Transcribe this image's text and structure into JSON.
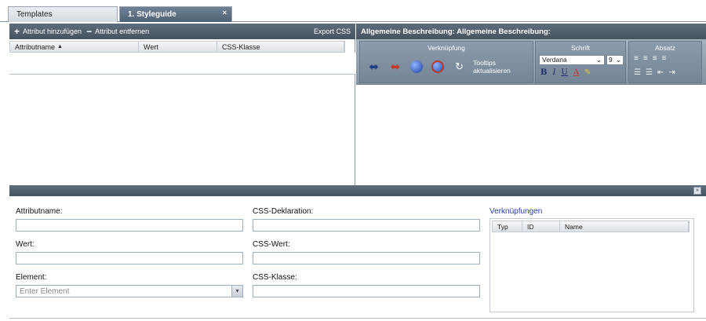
{
  "tabs": [
    {
      "label": "Templates"
    },
    {
      "label": "1. Styleguide",
      "close": "×"
    }
  ],
  "attributes_panel": {
    "add_label": "Attribut hinzufügen",
    "add_glyph": "+",
    "remove_label": "Attribut entfernen",
    "remove_glyph": "−",
    "export_label": "Export CSS",
    "columns": [
      "Attributname",
      "Wert",
      "CSS-Klasse"
    ],
    "sort_indicator": "▲"
  },
  "editor": {
    "title": "Allgemeine Beschreibung: Allgemeine Beschreibung:",
    "groups": {
      "link": "Verknüpfung",
      "font": "Schrift",
      "paragraph": "Absatz"
    },
    "tooltips_label": "Tooltips aktualisieren",
    "font_family": "Verdana",
    "font_size": "9",
    "format": {
      "bold": "B",
      "italic": "I",
      "underline": "U",
      "font_color": "A"
    }
  },
  "form": {
    "attributname_label": "Attributname:",
    "wert_label": "Wert:",
    "element_label": "Element:",
    "element_placeholder": "Enter Element",
    "css_deklaration_label": "CSS-Deklaration:",
    "css_wert_label": "CSS-Wert:",
    "css_klasse_label": "CSS-Klasse:"
  },
  "verknuepfungen": {
    "title": "Verknüpfungen",
    "columns": [
      "Typ",
      "ID",
      "Name"
    ]
  },
  "colors": {
    "toolbar_dark": "#4f6175",
    "link_blue": "#2c3ea6"
  }
}
